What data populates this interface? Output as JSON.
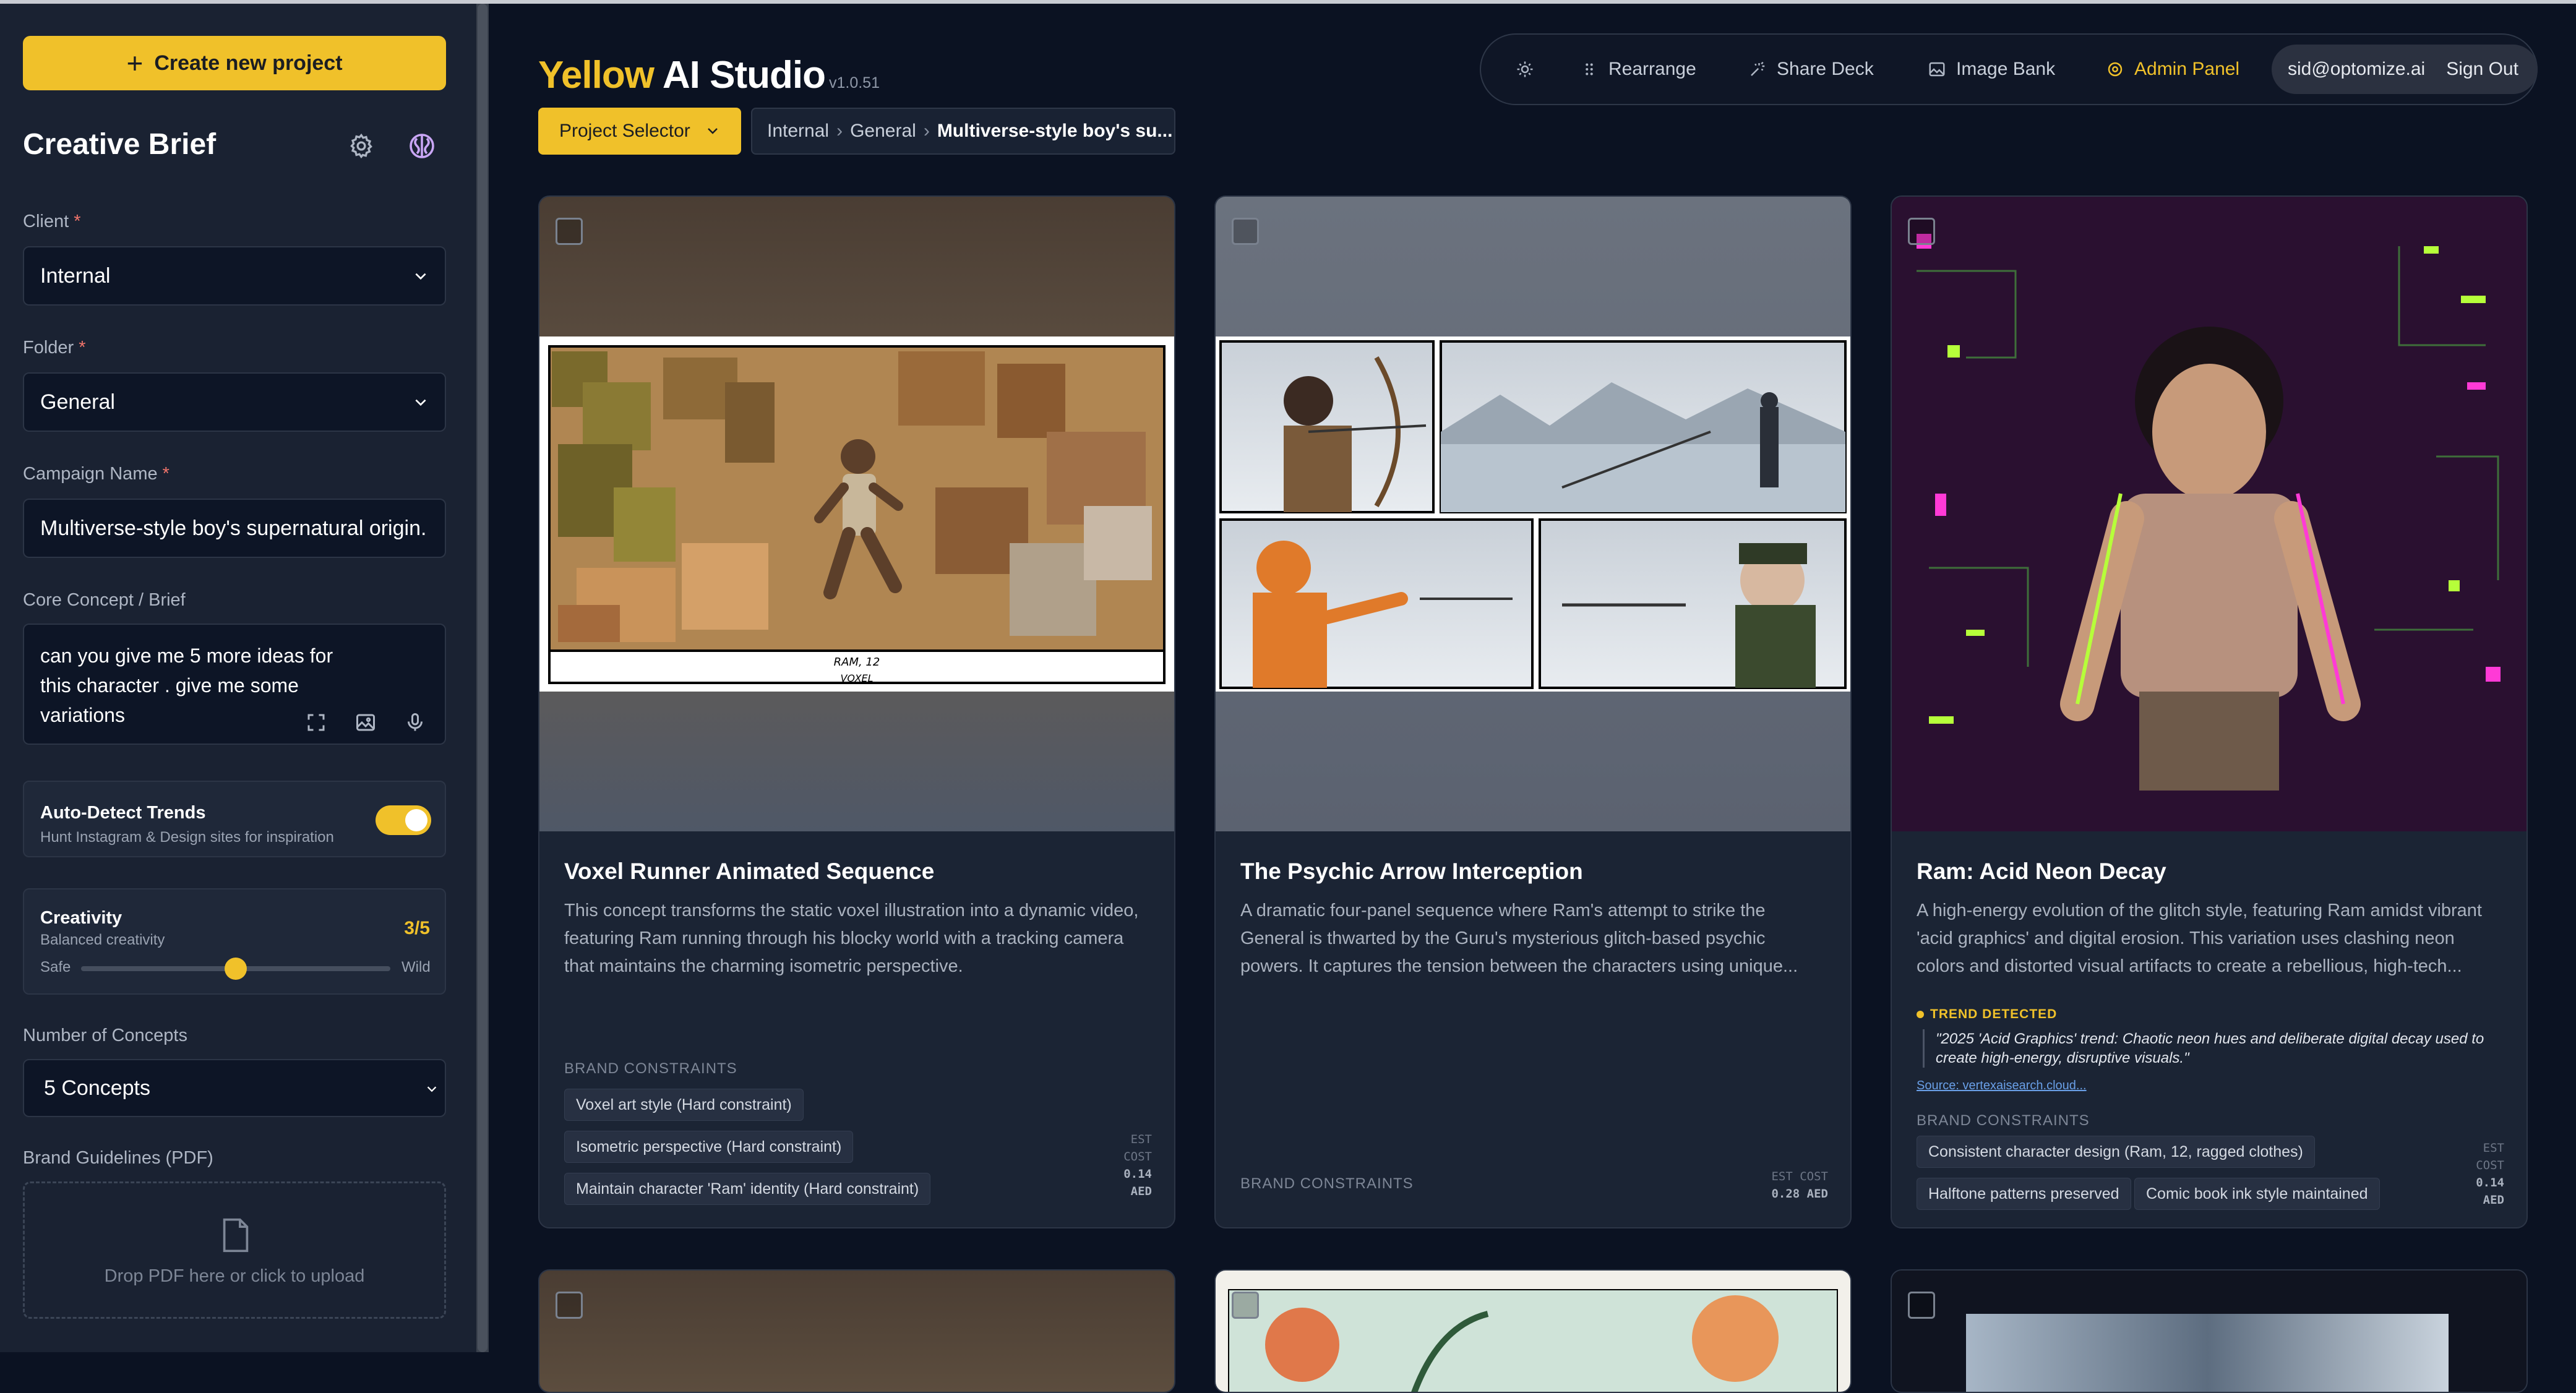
{
  "sidebar": {
    "create_button": "Create new project",
    "title": "Creative Brief",
    "client": {
      "label": "Client",
      "required": "*",
      "value": "Internal"
    },
    "folder": {
      "label": "Folder",
      "required": "*",
      "value": "General"
    },
    "campaign": {
      "label": "Campaign Name",
      "required": "*",
      "value": "Multiverse-style boy's supernatural origin."
    },
    "brief": {
      "label": "Core Concept / Brief",
      "value": "can you give me 5 more ideas for this character . give me some variations"
    },
    "trends": {
      "title": "Auto-Detect Trends",
      "subtitle": "Hunt Instagram & Design sites for inspiration",
      "enabled": true
    },
    "creativity": {
      "title": "Creativity",
      "subtitle": "Balanced creativity",
      "value_text": "3/5",
      "value": 3,
      "max": 5,
      "min_label": "Safe",
      "max_label": "Wild"
    },
    "concepts": {
      "label": "Number of Concepts",
      "value": "5 Concepts"
    },
    "guidelines": {
      "label": "Brand Guidelines (PDF)",
      "drop_text": "Drop PDF here or click to upload"
    }
  },
  "header": {
    "brand_yellow": "Yellow",
    "brand_rest": "AI Studio",
    "version": "v1.0.51",
    "project_selector": "Project Selector",
    "breadcrumb": [
      "Internal",
      "General",
      "Multiverse-style boy's su..."
    ],
    "breadcrumb_sep": "›"
  },
  "toolbar": {
    "rearrange": "Rearrange",
    "share": "Share Deck",
    "image_bank": "Image Bank",
    "admin": "Admin Panel",
    "user": "sid@optomize.ai",
    "sign_out": "Sign Out"
  },
  "cards": [
    {
      "title": "Voxel Runner Animated Sequence",
      "description": "This concept transforms the static voxel illustration into a dynamic video, featuring Ram running through his blocky world with a tracking camera that maintains the charming isometric perspective.",
      "constraints_label": "BRAND CONSTRAINTS",
      "constraints": [
        "Voxel art style (Hard constraint)",
        "Isometric perspective (Hard constraint)",
        "Maintain character 'Ram' identity (Hard constraint)"
      ],
      "cost_label_1": "EST",
      "cost_label_2": "COST",
      "cost_value": "0.14",
      "cost_currency": "AED",
      "caption_1": "RAM, 12",
      "caption_2": "VOXEL"
    },
    {
      "title": "The Psychic Arrow Interception",
      "description": "A dramatic four-panel sequence where Ram's attempt to strike the General is thwarted by the Guru's mysterious glitch-based psychic powers. It captures the tension between the characters using unique...",
      "constraints_label": "BRAND CONSTRAINTS",
      "cost_label": "EST COST",
      "cost_value": "0.28 AED"
    },
    {
      "title": "Ram: Acid Neon Decay",
      "description": "A high-energy evolution of the glitch style, featuring Ram amidst vibrant 'acid graphics' and digital erosion. This variation uses clashing neon colors and distorted visual artifacts to create a rebellious, high-tech...",
      "trend_label": "TREND DETECTED",
      "trend_quote": "\"2025 'Acid Graphics' trend: Chaotic neon hues and deliberate digital decay used to create high-energy, disruptive visuals.\"",
      "trend_source": "Source: vertexaisearch.cloud...",
      "constraints_label": "BRAND CONSTRAINTS",
      "constraints": [
        "Consistent character design (Ram, 12, ragged clothes)",
        "Halftone patterns preserved",
        "Comic book ink style maintained"
      ],
      "cost_label_1": "EST",
      "cost_label_2": "COST",
      "cost_value": "0.14",
      "cost_currency": "AED"
    }
  ]
}
